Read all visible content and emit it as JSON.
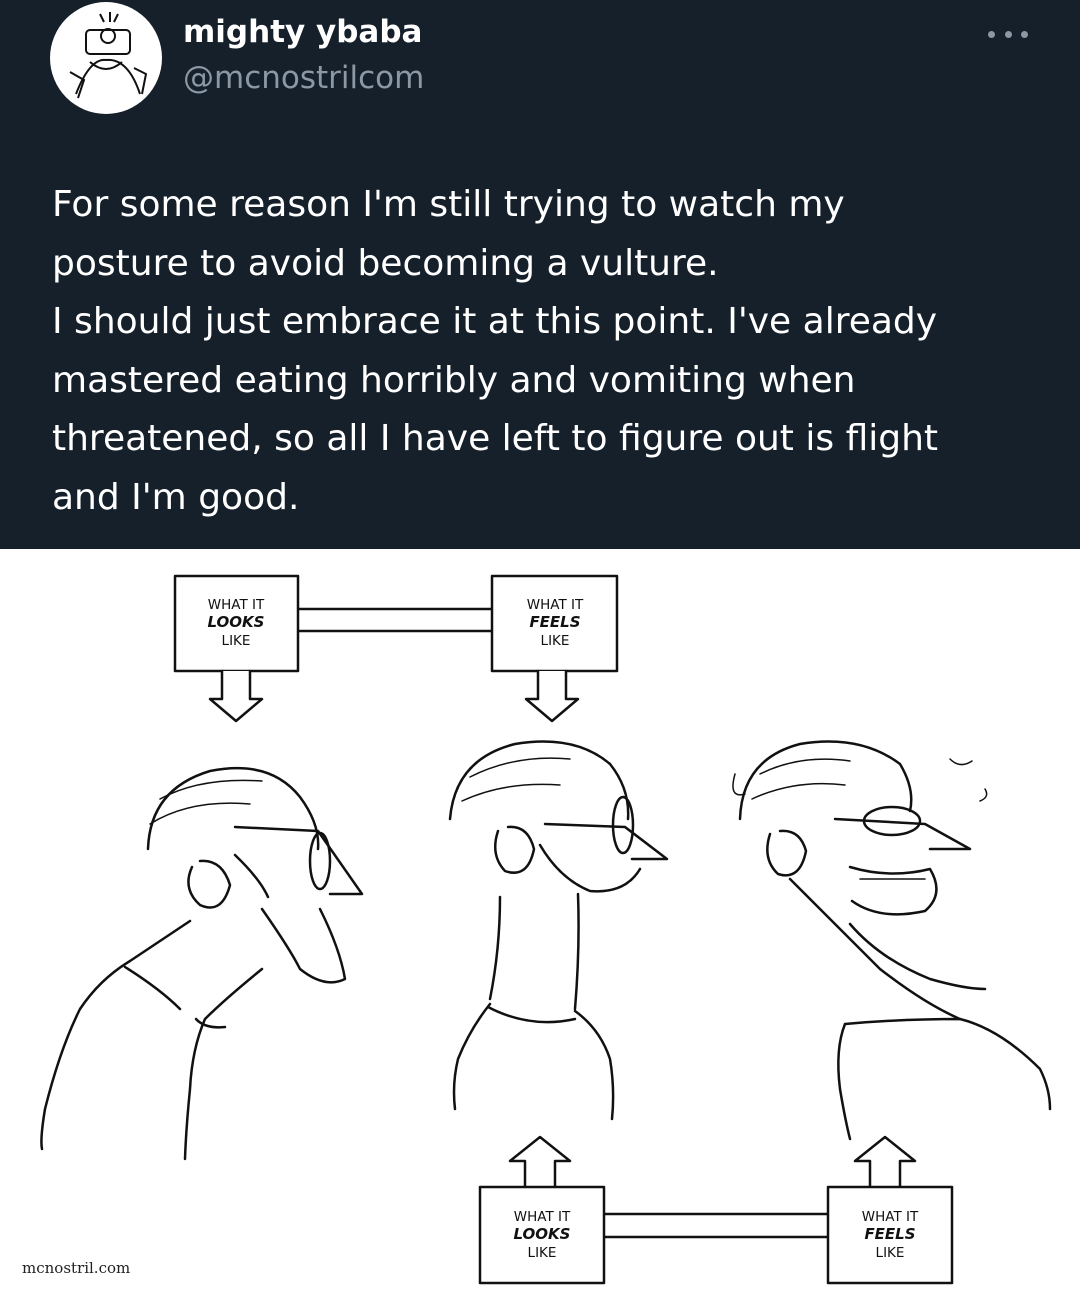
{
  "tweet": {
    "display_name": "mighty ybaba",
    "handle": "@mcnostrilcom",
    "text_lines": [
      "For some reason I'm still trying to watch my",
      "posture to avoid becoming a vulture.",
      "I should just embrace it at this point. I've already",
      "mastered eating horribly and vomiting when",
      "threatened, so all I have left to figure out is flight",
      "and I'm good."
    ]
  },
  "comic": {
    "top_left_box": [
      "WHAT IT",
      "LOOKS",
      "LIKE"
    ],
    "top_right_box": [
      "WHAT IT",
      "FEELS",
      "LIKE"
    ],
    "bottom_left_box": [
      "WHAT IT",
      "LOOKS",
      "LIKE"
    ],
    "bottom_right_box": [
      "WHAT IT",
      "FEELS",
      "LIKE"
    ],
    "watermark": "mcnostril.com"
  },
  "icons": {
    "more": "more-horizontal-icon",
    "avatar": "avatar-image"
  },
  "colors": {
    "background": "#15202b",
    "text_primary": "#ffffff",
    "text_secondary": "#8b98a5"
  }
}
